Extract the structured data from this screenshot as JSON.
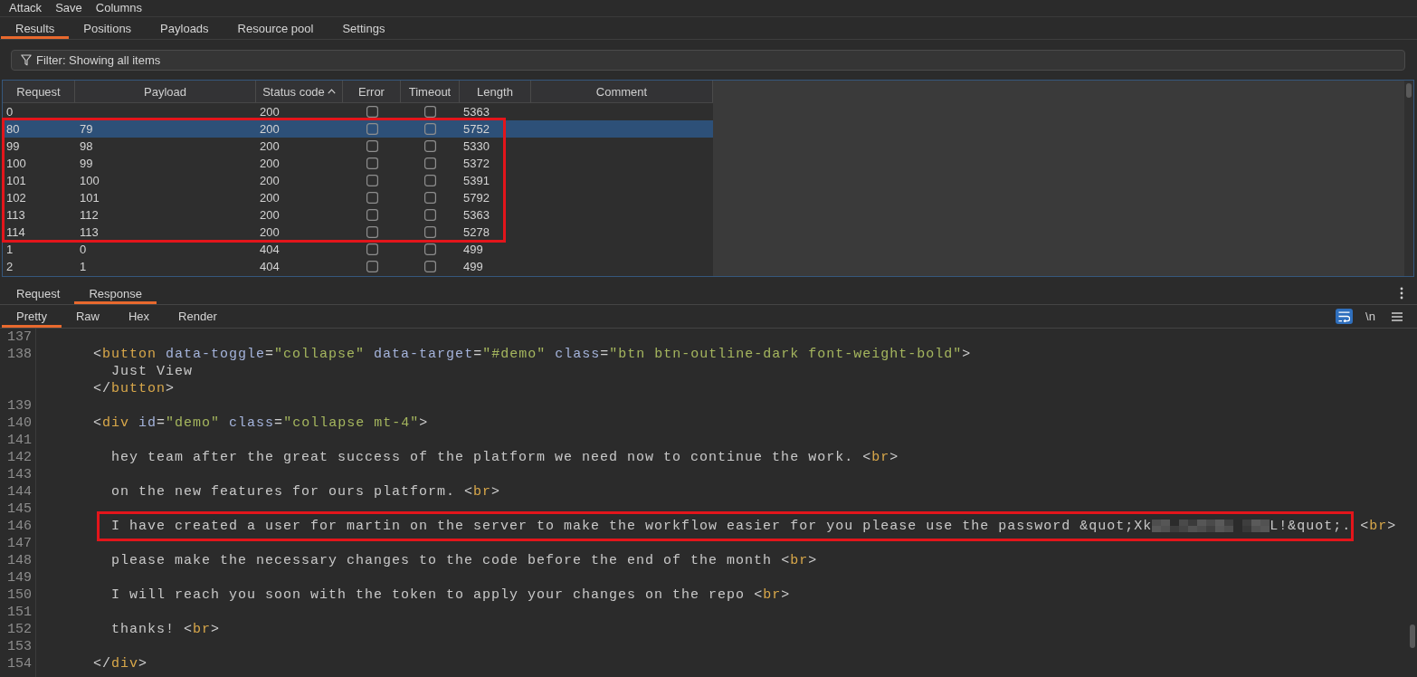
{
  "menu": [
    "Attack",
    "Save",
    "Columns"
  ],
  "tabs": [
    {
      "label": "Results",
      "selected": true
    },
    {
      "label": "Positions",
      "selected": false
    },
    {
      "label": "Payloads",
      "selected": false
    },
    {
      "label": "Resource pool",
      "selected": false
    },
    {
      "label": "Settings",
      "selected": false
    }
  ],
  "filter": {
    "label": "Filter: Showing all items"
  },
  "table": {
    "columns": [
      {
        "label": "Request",
        "sorted": false
      },
      {
        "label": "Payload",
        "sorted": false
      },
      {
        "label": "Status code",
        "sorted": true
      },
      {
        "label": "Error",
        "sorted": false
      },
      {
        "label": "Timeout",
        "sorted": false
      },
      {
        "label": "Length",
        "sorted": false
      },
      {
        "label": "Comment",
        "sorted": false
      }
    ],
    "rows": [
      {
        "kind": "row",
        "request": "0",
        "status_code": "200",
        "error": false,
        "timeout": false,
        "length": "5363",
        "selected": false
      },
      {
        "kind": "highlight",
        "rows": [
          {
            "kind": "row",
            "request": "80",
            "payload": "79",
            "status_code": "200",
            "error": false,
            "timeout": false,
            "length": "5752",
            "selected": true
          },
          {
            "kind": "row",
            "request": "99",
            "payload": "98",
            "status_code": "200",
            "error": false,
            "timeout": false,
            "length": "5330",
            "selected": false
          },
          {
            "kind": "row",
            "request": "100",
            "payload": "99",
            "status_code": "200",
            "error": false,
            "timeout": false,
            "length": "5372",
            "selected": false
          },
          {
            "kind": "row",
            "request": "101",
            "payload": "100",
            "status_code": "200",
            "error": false,
            "timeout": false,
            "length": "5391",
            "selected": false
          },
          {
            "kind": "row",
            "request": "102",
            "payload": "101",
            "status_code": "200",
            "error": false,
            "timeout": false,
            "length": "5792",
            "selected": false
          },
          {
            "kind": "row",
            "request": "113",
            "payload": "112",
            "status_code": "200",
            "error": false,
            "timeout": false,
            "length": "5363",
            "selected": false
          },
          {
            "kind": "row",
            "request": "114",
            "payload": "113",
            "status_code": "200",
            "error": false,
            "timeout": false,
            "length": "5278",
            "selected": false
          }
        ]
      },
      {
        "kind": "row",
        "request": "1",
        "payload": "0",
        "status_code": "404",
        "error": false,
        "timeout": false,
        "length": "499",
        "selected": false
      },
      {
        "kind": "row",
        "request": "2",
        "payload": "1",
        "status_code": "404",
        "error": false,
        "timeout": false,
        "length": "499",
        "selected": false
      }
    ]
  },
  "response_tabs": [
    {
      "label": "Request",
      "selected": false
    },
    {
      "label": "Response",
      "selected": true
    }
  ],
  "view_tabs": [
    {
      "label": "Pretty",
      "selected": true
    },
    {
      "label": "Raw",
      "selected": false
    },
    {
      "label": "Hex",
      "selected": false
    },
    {
      "label": "Render",
      "selected": false
    }
  ],
  "editor_toolbar": {
    "wrap_lines": {
      "selected": true
    },
    "newline_toggle": {
      "label": "\\n",
      "selected": false
    }
  },
  "editor": {
    "lines": [
      {
        "number": "137"
      },
      {
        "number": "138",
        "rows": [
          {
            "tokens": [
              {
                "kind": "punct",
                "text": "      <"
              },
              {
                "kind": "tag",
                "text": "button"
              },
              {
                "kind": "attr",
                "text": " data-toggle"
              },
              {
                "kind": "punct",
                "text": "="
              },
              {
                "kind": "value",
                "text": "\"collapse\""
              },
              {
                "kind": "attr",
                "text": " data-target"
              },
              {
                "kind": "punct",
                "text": "="
              },
              {
                "kind": "value",
                "text": "\"#demo\""
              },
              {
                "kind": "attr",
                "text": " class"
              },
              {
                "kind": "punct",
                "text": "="
              },
              {
                "kind": "value",
                "text": "\"btn btn-outline-dark font-weight-bold\""
              },
              {
                "kind": "punct",
                "text": ">"
              }
            ]
          },
          {
            "tokens": [
              {
                "kind": "text",
                "text": "        Just View"
              }
            ]
          },
          {
            "tokens": [
              {
                "kind": "punct",
                "text": "      </"
              },
              {
                "kind": "tag",
                "text": "button"
              },
              {
                "kind": "punct",
                "text": ">"
              }
            ]
          }
        ]
      },
      {
        "number": "139"
      },
      {
        "number": "140",
        "rows": [
          {
            "tokens": [
              {
                "kind": "punct",
                "text": "      <"
              },
              {
                "kind": "tag",
                "text": "div"
              },
              {
                "kind": "attr",
                "text": " id"
              },
              {
                "kind": "punct",
                "text": "="
              },
              {
                "kind": "value",
                "text": "\"demo\""
              },
              {
                "kind": "attr",
                "text": " class"
              },
              {
                "kind": "punct",
                "text": "="
              },
              {
                "kind": "value",
                "text": "\"collapse mt-4\""
              },
              {
                "kind": "punct",
                "text": ">"
              }
            ]
          }
        ]
      },
      {
        "number": "141"
      },
      {
        "number": "142",
        "rows": [
          {
            "tokens": [
              {
                "kind": "text",
                "text": "        hey team after the great success of the platform we need now to continue the work. "
              },
              {
                "kind": "punct",
                "text": "<"
              },
              {
                "kind": "tag",
                "text": "br"
              },
              {
                "kind": "punct",
                "text": ">"
              }
            ]
          }
        ]
      },
      {
        "number": "143"
      },
      {
        "number": "144",
        "rows": [
          {
            "tokens": [
              {
                "kind": "text",
                "text": "        on the new features for ours platform. "
              },
              {
                "kind": "punct",
                "text": "<"
              },
              {
                "kind": "tag",
                "text": "br"
              },
              {
                "kind": "punct",
                "text": ">"
              }
            ]
          }
        ]
      },
      {
        "number": "145"
      },
      {
        "number": "146",
        "rows": [
          {
            "tokens": [
              {
                "kind": "highlight",
                "tokens": [
                  {
                    "kind": "text",
                    "text": "        I have created a user for martin on the server to make the workflow easier for you please use the password &quot;Xk"
                  },
                  {
                    "kind": "redacted"
                  },
                  {
                    "kind": "text",
                    "text": "L!&quot;."
                  }
                ]
              },
              {
                "kind": "punct",
                "text": " <"
              },
              {
                "kind": "tag",
                "text": "br"
              },
              {
                "kind": "punct",
                "text": ">"
              }
            ]
          }
        ]
      },
      {
        "number": "147"
      },
      {
        "number": "148",
        "rows": [
          {
            "tokens": [
              {
                "kind": "text",
                "text": "        please make the necessary changes to the code before the end of the month "
              },
              {
                "kind": "punct",
                "text": "<"
              },
              {
                "kind": "tag",
                "text": "br"
              },
              {
                "kind": "punct",
                "text": ">"
              }
            ]
          }
        ]
      },
      {
        "number": "149"
      },
      {
        "number": "150",
        "rows": [
          {
            "tokens": [
              {
                "kind": "text",
                "text": "        I will reach you soon with the token to apply your changes on the repo "
              },
              {
                "kind": "punct",
                "text": "<"
              },
              {
                "kind": "tag",
                "text": "br"
              },
              {
                "kind": "punct",
                "text": ">"
              }
            ]
          }
        ]
      },
      {
        "number": "151"
      },
      {
        "number": "152",
        "rows": [
          {
            "tokens": [
              {
                "kind": "text",
                "text": "        thanks! "
              },
              {
                "kind": "punct",
                "text": "<"
              },
              {
                "kind": "tag",
                "text": "br"
              },
              {
                "kind": "punct",
                "text": ">"
              }
            ]
          }
        ]
      },
      {
        "number": "153"
      },
      {
        "number": "154",
        "rows": [
          {
            "tokens": [
              {
                "kind": "punct",
                "text": "      </"
              },
              {
                "kind": "tag",
                "text": "div"
              },
              {
                "kind": "punct",
                "text": ">"
              }
            ]
          }
        ]
      }
    ]
  }
}
